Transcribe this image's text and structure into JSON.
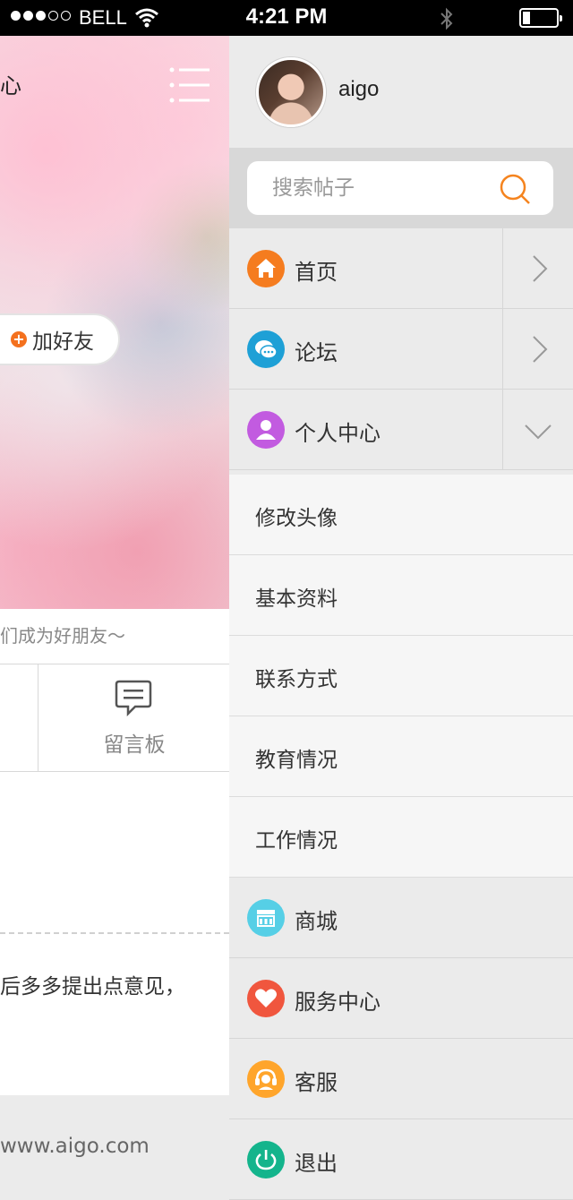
{
  "status_bar": {
    "carrier": "BELL",
    "time": "4:21 PM",
    "signal_dots_filled": 3,
    "signal_dots_total": 5
  },
  "background_page": {
    "title_fragment": "心",
    "add_friend_label": "加好友",
    "subtitle_fragment": "们成为好朋友～",
    "message_board_label": "留言板",
    "feedback_fragment": "后多多提出点意见，",
    "footer_url_fragment": "www.aigo.com"
  },
  "drawer": {
    "username": "aigo",
    "search": {
      "placeholder": "搜索帖子"
    },
    "nav": [
      {
        "label": "首页",
        "icon": "home-icon",
        "color": "#f57c1f",
        "arrow": "right"
      },
      {
        "label": "论坛",
        "icon": "chat-icon",
        "color": "#1ea0d6",
        "arrow": "right"
      },
      {
        "label": "个人中心",
        "icon": "user-icon",
        "color": "#c25be0",
        "arrow": "down"
      }
    ],
    "sub_items": [
      "修改头像",
      "基本资料",
      "联系方式",
      "教育情况",
      "工作情况"
    ],
    "nav_bottom": [
      {
        "label": "商城",
        "icon": "shop-icon",
        "color": "#56cfe6"
      },
      {
        "label": "服务中心",
        "icon": "heart-icon",
        "color": "#f0563e"
      },
      {
        "label": "客服",
        "icon": "headset-icon",
        "color": "#ffa52b"
      },
      {
        "label": "退出",
        "icon": "power-icon",
        "color": "#14b48c"
      }
    ]
  }
}
